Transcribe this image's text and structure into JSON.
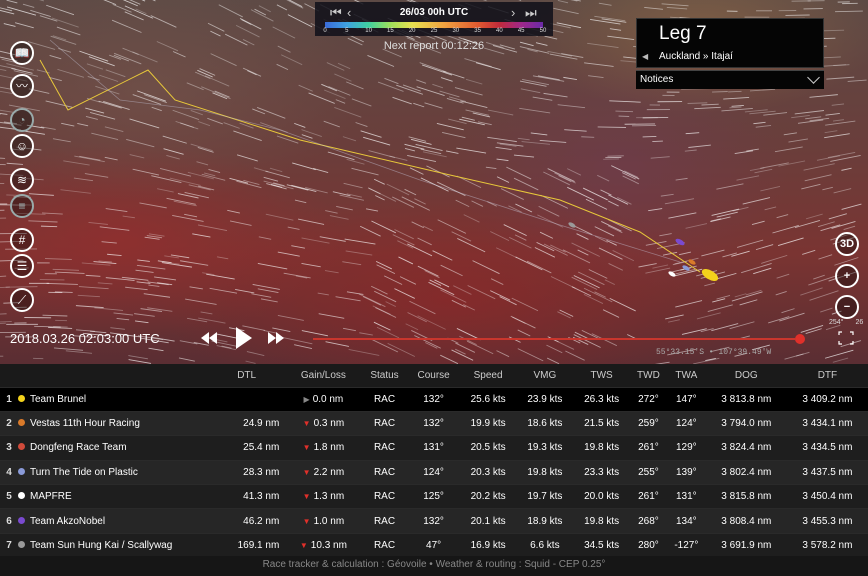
{
  "topbar": {
    "date_label": "26/03 00h UTC",
    "wind_scale": [
      "0",
      "5",
      "10",
      "15",
      "20",
      "25",
      "30",
      "35",
      "40",
      "45",
      "50"
    ],
    "next_report": "Next report 00:12:26"
  },
  "leg": {
    "title": "Leg 7",
    "route": "Auckland » Itajaí",
    "notices_label": "Notices"
  },
  "map": {
    "timestamp": "2018.03.26 02:03:00 UTC",
    "coordinates": "55°33.15'S • 107°39.49'W",
    "heading": "254°",
    "heading_other": "26",
    "button_3d": "3D",
    "timeline_progress": 0.99
  },
  "table": {
    "headers": [
      "DTL",
      "Gain/Loss",
      "Status",
      "Course",
      "Speed",
      "VMG",
      "TWS",
      "TWD",
      "TWA",
      "DOG",
      "DTF"
    ],
    "rows": [
      {
        "rank": "1",
        "color": "#f3d21c",
        "team": "Team Brunel",
        "dtl": "",
        "gain_dir": "neutral",
        "gain": "0.0 nm",
        "status": "RAC",
        "course": "132°",
        "speed": "25.6 kts",
        "vmg": "23.9 kts",
        "tws": "26.3 kts",
        "twd": "272°",
        "twa": "147°",
        "dog": "3 813.8 nm",
        "dtf": "3 409.2 nm"
      },
      {
        "rank": "2",
        "color": "#d97a2a",
        "team": "Vestas 11th Hour Racing",
        "dtl": "24.9 nm",
        "gain_dir": "down",
        "gain": "0.3 nm",
        "status": "RAC",
        "course": "132°",
        "speed": "19.9 kts",
        "vmg": "18.6 kts",
        "tws": "21.5 kts",
        "twd": "259°",
        "twa": "124°",
        "dog": "3 794.0 nm",
        "dtf": "3 434.1 nm"
      },
      {
        "rank": "3",
        "color": "#d04a3a",
        "team": "Dongfeng Race Team",
        "dtl": "25.4 nm",
        "gain_dir": "down",
        "gain": "1.8 nm",
        "status": "RAC",
        "course": "131°",
        "speed": "20.5 kts",
        "vmg": "19.3 kts",
        "tws": "19.8 kts",
        "twd": "261°",
        "twa": "129°",
        "dog": "3 824.4 nm",
        "dtf": "3 434.5 nm"
      },
      {
        "rank": "4",
        "color": "#8a9ad8",
        "team": "Turn The Tide on Plastic",
        "dtl": "28.3 nm",
        "gain_dir": "down",
        "gain": "2.2 nm",
        "status": "RAC",
        "course": "124°",
        "speed": "20.3 kts",
        "vmg": "19.8 kts",
        "tws": "23.3 kts",
        "twd": "255°",
        "twa": "139°",
        "dog": "3 802.4 nm",
        "dtf": "3 437.5 nm"
      },
      {
        "rank": "5",
        "color": "#ffffff",
        "team": "MAPFRE",
        "dtl": "41.3 nm",
        "gain_dir": "down",
        "gain": "1.3 nm",
        "status": "RAC",
        "course": "125°",
        "speed": "20.2 kts",
        "vmg": "19.7 kts",
        "tws": "20.0 kts",
        "twd": "261°",
        "twa": "131°",
        "dog": "3 815.8 nm",
        "dtf": "3 450.4 nm"
      },
      {
        "rank": "6",
        "color": "#7a4ad0",
        "team": "Team AkzoNobel",
        "dtl": "46.2 nm",
        "gain_dir": "down",
        "gain": "1.0 nm",
        "status": "RAC",
        "course": "132°",
        "speed": "20.1 kts",
        "vmg": "18.9 kts",
        "tws": "19.8 kts",
        "twd": "268°",
        "twa": "134°",
        "dog": "3 808.4 nm",
        "dtf": "3 455.3 nm"
      },
      {
        "rank": "7",
        "color": "#9a9a9a",
        "team": "Team Sun Hung Kai / Scallywag",
        "dtl": "169.1 nm",
        "gain_dir": "down",
        "gain": "10.3 nm",
        "status": "RAC",
        "course": "47°",
        "speed": "16.9 kts",
        "vmg": "6.6 kts",
        "tws": "34.5 kts",
        "twd": "280°",
        "twa": "-127°",
        "dog": "3 691.9 nm",
        "dtf": "3 578.2 nm"
      }
    ]
  },
  "footer": "Race tracker & calculation : Géovoile • Weather & routing : Squid - CEP 0.25°",
  "icons": {
    "left": [
      "book-icon",
      "route-icon",
      "compass-icon",
      "skipper-icon",
      "wind-icon",
      "layers-icon",
      "grid-icon",
      "list-icon",
      "chart-icon"
    ],
    "right": [
      "3d-icon",
      "zoom-in-icon",
      "zoom-out-icon"
    ]
  },
  "colors": {
    "accent": "#c9362d",
    "leader": "#f3d21c",
    "loss": "#e0302a"
  }
}
